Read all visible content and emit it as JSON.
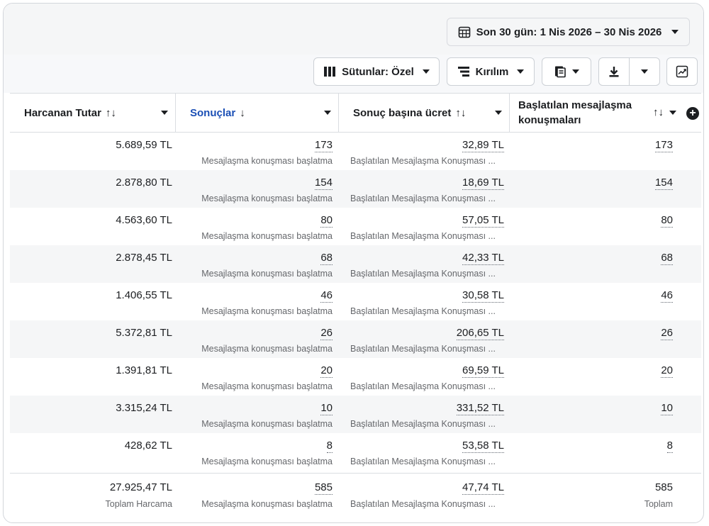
{
  "date_range": {
    "label": "Son 30 gün: 1 Nis 2026 – 30 Nis 2026",
    "icon": "calendar-icon"
  },
  "toolbar": {
    "columns_label": "Sütunlar: Özel",
    "breakdown_label": "Kırılım"
  },
  "table": {
    "headers": {
      "spent": "Harcanan Tutar",
      "results": "Sonuçlar",
      "cost_per_result": "Sonuç başına ücret",
      "conversations_line1": "Başlatılan mesajlaşma",
      "conversations_line2": "konuşmaları"
    },
    "rows": [
      {
        "spent": "5.689,59 TL",
        "results": "173",
        "results_sub": "Mesajlaşma konuşması başlatma",
        "cost": "32,89 TL",
        "cost_sub": "Başlatılan Mesajlaşma Konuşması ...",
        "conversations": "173"
      },
      {
        "spent": "2.878,80 TL",
        "results": "154",
        "results_sub": "Mesajlaşma konuşması başlatma",
        "cost": "18,69 TL",
        "cost_sub": "Başlatılan Mesajlaşma Konuşması ...",
        "conversations": "154"
      },
      {
        "spent": "4.563,60 TL",
        "results": "80",
        "results_sub": "Mesajlaşma konuşması başlatma",
        "cost": "57,05 TL",
        "cost_sub": "Başlatılan Mesajlaşma Konuşması ...",
        "conversations": "80"
      },
      {
        "spent": "2.878,45 TL",
        "results": "68",
        "results_sub": "Mesajlaşma konuşması başlatma",
        "cost": "42,33 TL",
        "cost_sub": "Başlatılan Mesajlaşma Konuşması ...",
        "conversations": "68"
      },
      {
        "spent": "1.406,55 TL",
        "results": "46",
        "results_sub": "Mesajlaşma konuşması başlatma",
        "cost": "30,58 TL",
        "cost_sub": "Başlatılan Mesajlaşma Konuşması ...",
        "conversations": "46"
      },
      {
        "spent": "5.372,81 TL",
        "results": "26",
        "results_sub": "Mesajlaşma konuşması başlatma",
        "cost": "206,65 TL",
        "cost_sub": "Başlatılan Mesajlaşma Konuşması ...",
        "conversations": "26"
      },
      {
        "spent": "1.391,81 TL",
        "results": "20",
        "results_sub": "Mesajlaşma konuşması başlatma",
        "cost": "69,59 TL",
        "cost_sub": "Başlatılan Mesajlaşma Konuşması ...",
        "conversations": "20"
      },
      {
        "spent": "3.315,24 TL",
        "results": "10",
        "results_sub": "Mesajlaşma konuşması başlatma",
        "cost": "331,52 TL",
        "cost_sub": "Başlatılan Mesajlaşma Konuşması ...",
        "conversations": "10"
      },
      {
        "spent": "428,62 TL",
        "results": "8",
        "results_sub": "Mesajlaşma konuşması başlatma",
        "cost": "53,58 TL",
        "cost_sub": "Başlatılan Mesajlaşma Konuşması ...",
        "conversations": "8"
      }
    ],
    "totals": {
      "spent": "27.925,47 TL",
      "spent_sub": "Toplam Harcama",
      "results": "585",
      "results_sub": "Mesajlaşma konuşması başlatma",
      "cost": "47,74 TL",
      "cost_sub": "Başlatılan Mesajlaşma Konuşması ...",
      "conversations": "585",
      "conversations_sub": "Toplam"
    }
  },
  "colors": {
    "accent": "#1b4fb5",
    "border": "#dadde1",
    "stripe": "#f5f6f7",
    "muted": "#65676b"
  }
}
